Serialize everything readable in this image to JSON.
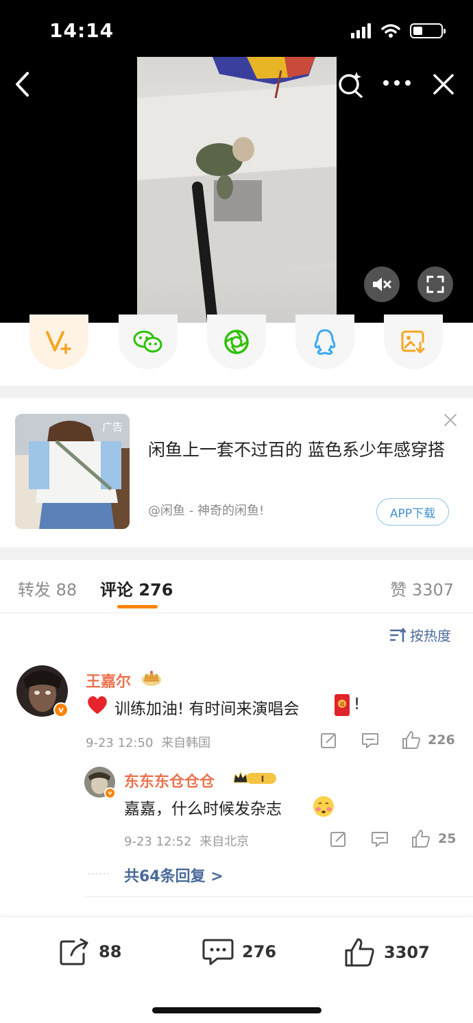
{
  "status_bar": {
    "time": "14:14",
    "battery_percent": 30
  },
  "colors": {
    "brand_orange": "#ff8200",
    "link_blue": "#4a6b9a",
    "username_orange": "#eb7350"
  },
  "video": {
    "back_icon": "chevron-left-icon",
    "search_icon": "search-sparkle-icon",
    "more_icon": "more-horizontal-icon",
    "close_icon": "close-icon",
    "mute_icon": "speaker-muted-icon",
    "fullscreen_icon": "fullscreen-icon"
  },
  "share_targets": [
    {
      "icon": "weibo-vplus-icon",
      "color": "#f5a623"
    },
    {
      "icon": "wechat-icon",
      "color": "#2dc100"
    },
    {
      "icon": "moments-icon",
      "color": "#2dc100"
    },
    {
      "icon": "qq-icon",
      "color": "#3aa8f0"
    },
    {
      "icon": "save-image-icon",
      "color": "#f5a623"
    }
  ],
  "ad": {
    "tag": "广告",
    "title": "闲鱼上一套不过百的 蓝色系少年感穿搭",
    "source": "@闲鱼 - 神奇的闲鱼!",
    "button": "APP下载"
  },
  "tabs": {
    "repost_label": "转发",
    "repost_count": "88",
    "comment_label": "评论",
    "comment_count": "276",
    "like_label": "赞",
    "like_count": "3307"
  },
  "sort_label": "按热度",
  "comments": [
    {
      "user": "王嘉尔",
      "text": "训练加油! 有时间来演唱会",
      "text_suffix": "!",
      "time": "9-23 12:50",
      "location": "来自韩国",
      "likes": "226"
    }
  ],
  "reply": {
    "user": "东东东仓仓仓",
    "text": "嘉嘉，什么时候发杂志",
    "time": "9-23 12:52",
    "location": "来自北京",
    "likes": "25"
  },
  "more_replies": "共64条回复 >",
  "bottom_bar": {
    "repost": "88",
    "comment": "276",
    "like": "3307"
  }
}
